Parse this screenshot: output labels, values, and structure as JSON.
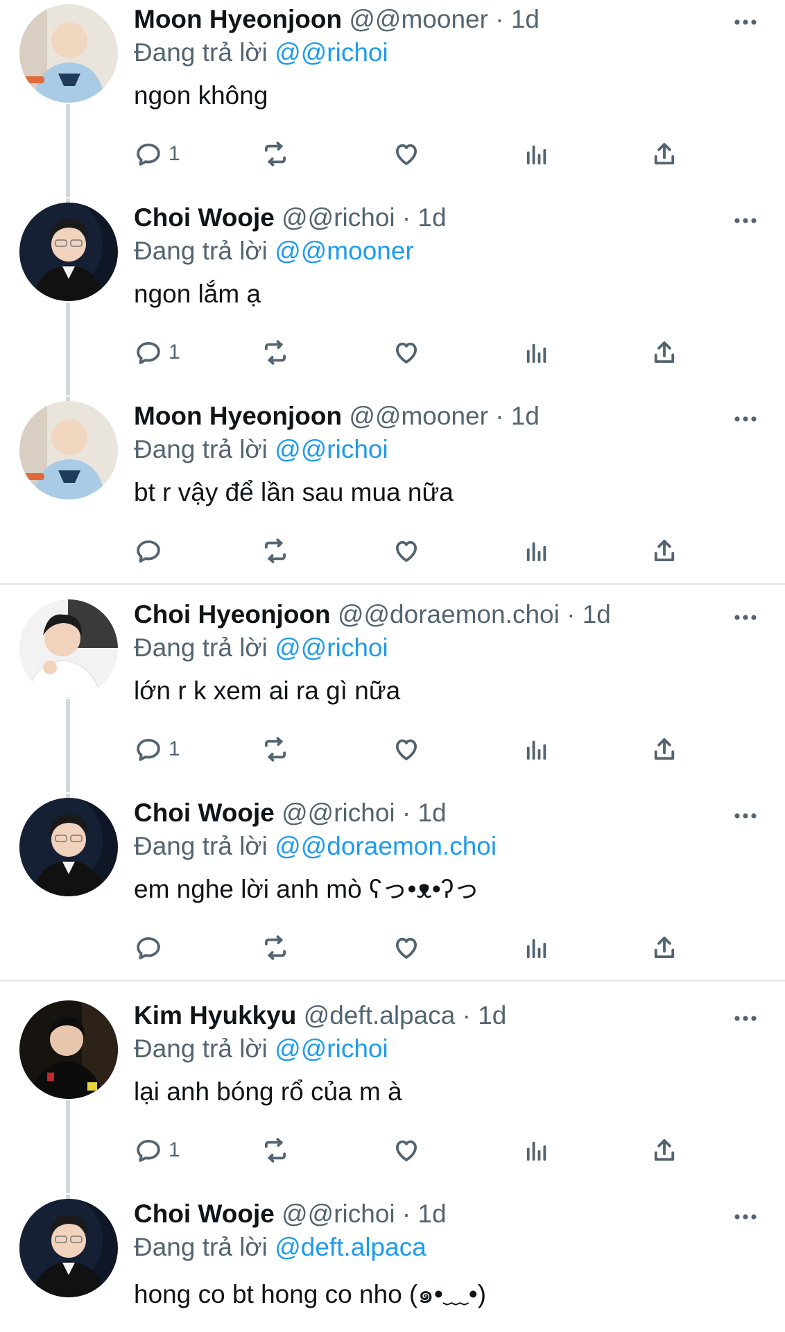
{
  "tweets": [
    {
      "name": "Moon Hyeonjoon",
      "handle": "@@mooner",
      "dot": "·",
      "time": "1d",
      "reply_prefix": "Đang trả lời",
      "reply_to": "@@richoi",
      "text": "ngon không",
      "reply_count": "1",
      "avatar": "light"
    },
    {
      "name": "Choi Wooje",
      "handle": "@@richoi",
      "dot": "·",
      "time": "1d",
      "reply_prefix": "Đang trả lời",
      "reply_to": "@@mooner",
      "text": "ngon lắm ạ",
      "reply_count": "1",
      "avatar": "dark"
    },
    {
      "name": "Moon Hyeonjoon",
      "handle": "@@mooner",
      "dot": "·",
      "time": "1d",
      "reply_prefix": "Đang trả lời",
      "reply_to": "@@richoi",
      "text": "bt r vậy để lần sau mua nữa",
      "reply_count": "",
      "avatar": "light"
    },
    {
      "name": "Choi Hyeonjoon",
      "handle": "@@doraemon.choi",
      "dot": "·",
      "time": "1d",
      "reply_prefix": "Đang trả lời",
      "reply_to": "@@richoi",
      "text": "lớn r k xem ai ra gì nữa",
      "reply_count": "1",
      "avatar": "white"
    },
    {
      "name": "Choi Wooje",
      "handle": "@@richoi",
      "dot": "·",
      "time": "1d",
      "reply_prefix": "Đang trả lời",
      "reply_to": "@@doraemon.choi",
      "text": "em nghe lời anh mò ʕっ•ᴥ•ʔっ",
      "reply_count": "",
      "avatar": "dark"
    },
    {
      "name": "Kim Hyukkyu",
      "handle": "@deft.alpaca",
      "dot": "·",
      "time": "1d",
      "reply_prefix": "Đang trả lời",
      "reply_to": "@@richoi",
      "text": "lại anh bóng rổ của m à",
      "reply_count": "1",
      "avatar": "black"
    },
    {
      "name": "Choi Wooje",
      "handle": "@@richoi",
      "dot": "·",
      "time": "1d",
      "reply_prefix": "Đang trả lời",
      "reply_to": "@deft.alpaca",
      "text": "hong co bt hong co nho (๑•﹏•)",
      "reply_count": "",
      "avatar": "dark"
    }
  ],
  "icons": {
    "more": "more-dots-icon",
    "reply": "reply-icon",
    "retweet": "retweet-icon",
    "like": "heart-icon",
    "views": "views-chart-icon",
    "share": "share-icon"
  },
  "colors": {
    "link": "#1d9bf0",
    "muted": "#536471",
    "text": "#0f1419",
    "divider": "#e7e9ea",
    "thread": "#cfd9de"
  }
}
